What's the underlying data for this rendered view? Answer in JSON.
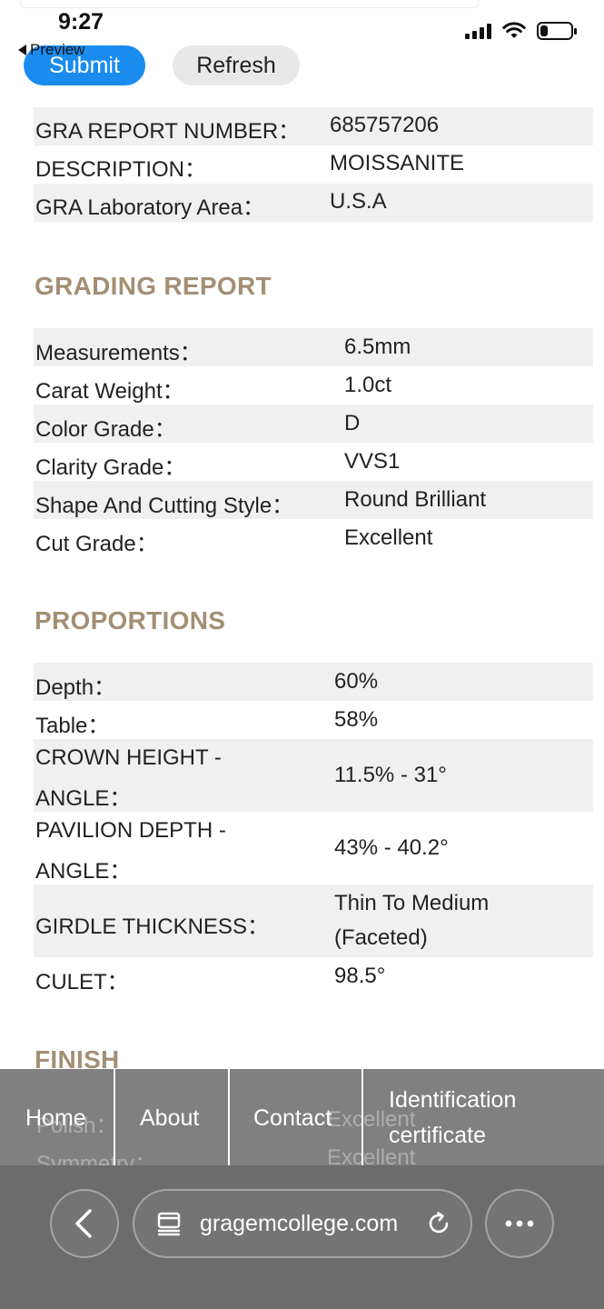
{
  "status_bar": {
    "time": "9:27",
    "battery_level": 0.25
  },
  "controls": {
    "preview_label": "Preview",
    "submit_label": "Submit",
    "refresh_label": "Refresh"
  },
  "report_info": [
    {
      "label": "GRA REPORT NUMBER：",
      "value": "685757206"
    },
    {
      "label": "DESCRIPTION：",
      "value": "MOISSANITE"
    },
    {
      "label": "GRA Laboratory Area：",
      "value": "U.S.A"
    }
  ],
  "grading_report": {
    "title": "GRADING REPORT",
    "rows": [
      {
        "label": "Measurements：",
        "value": "6.5mm"
      },
      {
        "label": "Carat Weight：",
        "value": "1.0ct"
      },
      {
        "label": "Color Grade：",
        "value": "D"
      },
      {
        "label": "Clarity Grade：",
        "value": "VVS1"
      },
      {
        "label": "Shape And Cutting Style：",
        "value": "Round Brilliant"
      },
      {
        "label": "Cut Grade：",
        "value": "Excellent"
      }
    ]
  },
  "proportions": {
    "title": "PROPORTIONS",
    "rows": [
      {
        "label": "Depth：",
        "value": "60%"
      },
      {
        "label": "Table：",
        "value": "58%"
      },
      {
        "label_line1": "CROWN HEIGHT -",
        "label_line2": "ANGLE：",
        "value": "11.5% - 31°"
      },
      {
        "label_line1": "PAVILION DEPTH -",
        "label_line2": "ANGLE：",
        "value": "43% - 40.2°"
      },
      {
        "label": "GIRDLE THICKNESS：",
        "value_line1": "Thin To Medium",
        "value_line2": "(Faceted)"
      },
      {
        "label": "CULET：",
        "value": "98.5°"
      }
    ]
  },
  "finish": {
    "title": "FINISH",
    "rows": [
      {
        "label": "Polish：",
        "value": "Excellent"
      },
      {
        "label": "Symmetry：",
        "value": "Excellent"
      }
    ]
  },
  "site_nav": {
    "items": [
      "Home",
      "About",
      "Contact"
    ],
    "identification_line1": "Identification",
    "identification_line2": "certificate"
  },
  "browser": {
    "url": "gragemcollege.com"
  },
  "colors": {
    "section_title": "#a38f74",
    "submit_bg": "#1a8cf0",
    "row_alt": "#f0f0f0"
  }
}
